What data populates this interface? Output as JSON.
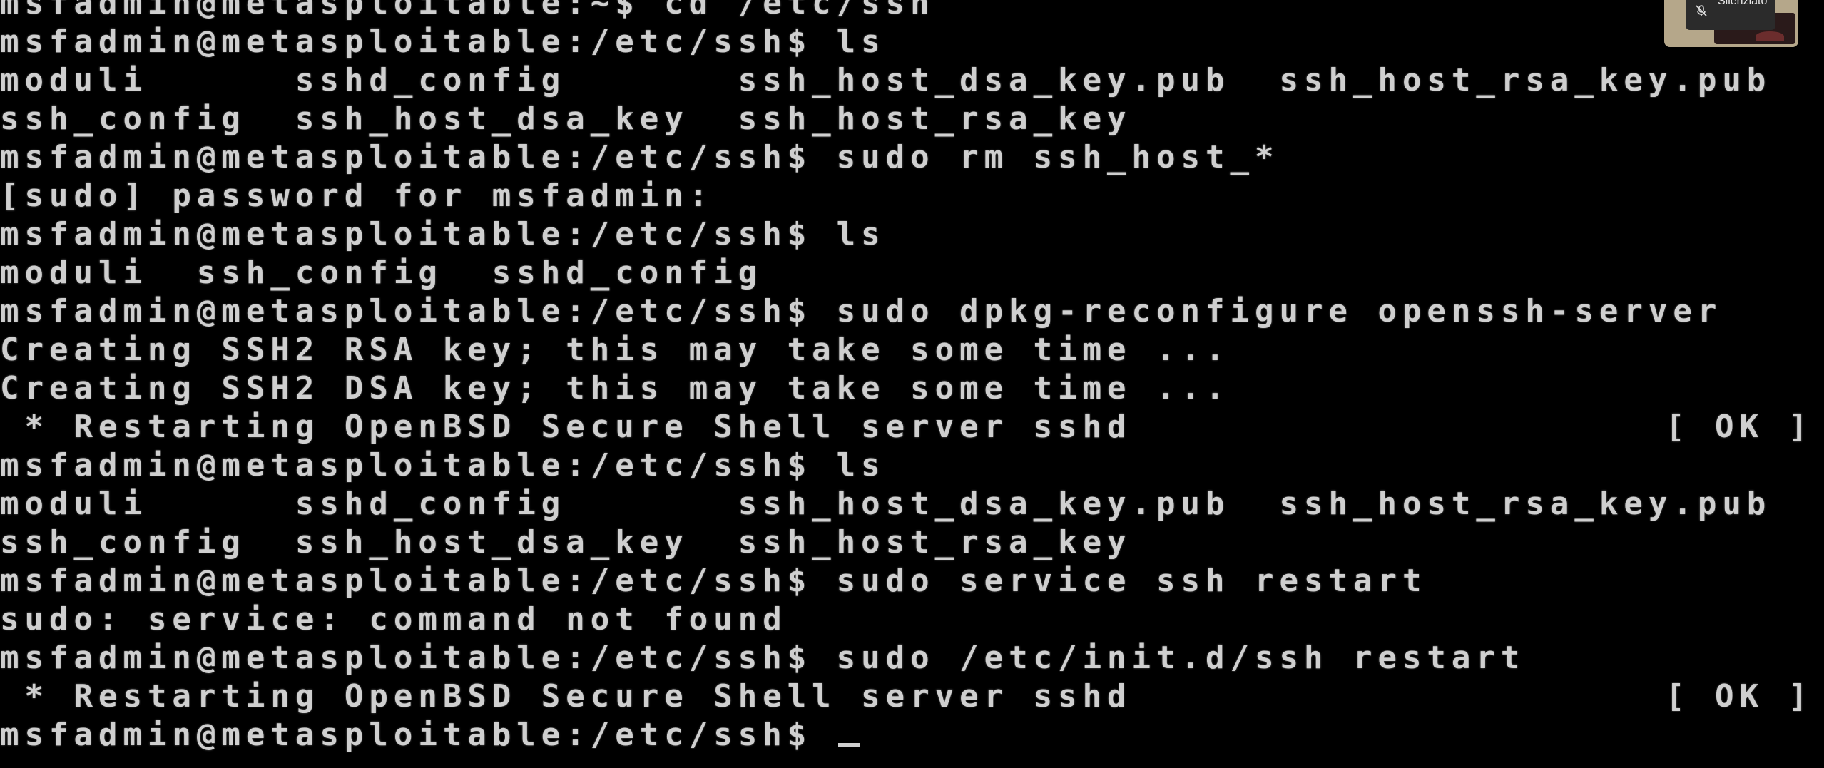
{
  "terminal": {
    "lines": [
      "msfadmin@metasploitable:~$ cd /etc/ssh",
      "msfadmin@metasploitable:/etc/ssh$ ls",
      "moduli      sshd_config       ssh_host_dsa_key.pub  ssh_host_rsa_key.pub",
      "ssh_config  ssh_host_dsa_key  ssh_host_rsa_key",
      "msfadmin@metasploitable:/etc/ssh$ sudo rm ssh_host_*",
      "[sudo] password for msfadmin:",
      "msfadmin@metasploitable:/etc/ssh$ ls",
      "moduli  ssh_config  sshd_config",
      "msfadmin@metasploitable:/etc/ssh$ sudo dpkg-reconfigure openssh-server",
      "Creating SSH2 RSA key; this may take some time ...",
      "Creating SSH2 DSA key; this may take some time ...",
      " * Restarting OpenBSD Secure Shell server sshd",
      "msfadmin@metasploitable:/etc/ssh$ ls",
      "moduli      sshd_config       ssh_host_dsa_key.pub  ssh_host_rsa_key.pub",
      "ssh_config  ssh_host_dsa_key  ssh_host_rsa_key",
      "msfadmin@metasploitable:/etc/ssh$ sudo service ssh restart",
      "sudo: service: command not found",
      "msfadmin@metasploitable:/etc/ssh$ sudo /etc/init.d/ssh restart",
      " * Restarting OpenBSD Secure Shell server sshd",
      "msfadmin@metasploitable:/etc/ssh$ "
    ],
    "status_ok": "[ OK ]",
    "text_color": "#cfcfcf",
    "background": "#000000"
  },
  "participant": {
    "mute_label": "Silenziato",
    "mute_icon": "microphone-muted-icon"
  }
}
